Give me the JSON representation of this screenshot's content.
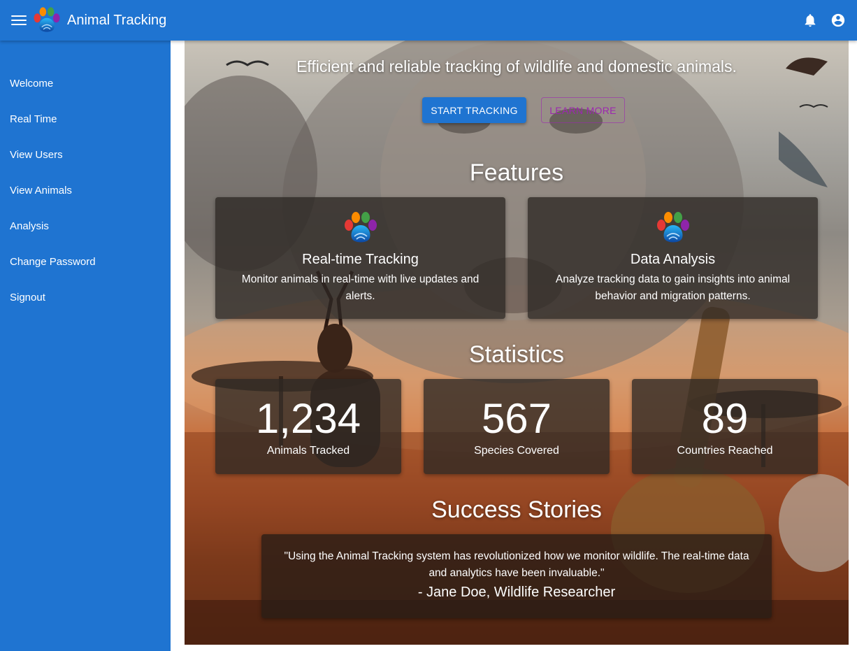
{
  "app": {
    "title": "Animal Tracking"
  },
  "icons": {
    "menu": "menu-icon",
    "logo": "paw-logo-icon",
    "notifications": "bell-icon",
    "account": "account-circle-icon",
    "feature": "paw-icon"
  },
  "colors": {
    "primary": "#1f74d1",
    "secondary": "#9c27b0"
  },
  "sidebar": {
    "items": [
      {
        "label": "Welcome"
      },
      {
        "label": "Real Time"
      },
      {
        "label": "View Users"
      },
      {
        "label": "View Animals"
      },
      {
        "label": "Analysis"
      },
      {
        "label": "Change Password"
      },
      {
        "label": "Signout"
      }
    ]
  },
  "hero": {
    "tagline": "Efficient and reliable tracking of wildlife and domestic animals.",
    "start_label": "START TRACKING",
    "learn_label": "LEARN MORE"
  },
  "features": {
    "title": "Features",
    "items": [
      {
        "title": "Real-time Tracking",
        "description": "Monitor animals in real-time with live updates and alerts."
      },
      {
        "title": "Data Analysis",
        "description": "Analyze tracking data to gain insights into animal behavior and migration patterns."
      }
    ]
  },
  "statistics": {
    "title": "Statistics",
    "items": [
      {
        "value": "1,234",
        "label": "Animals Tracked"
      },
      {
        "value": "567",
        "label": "Species Covered"
      },
      {
        "value": "89",
        "label": "Countries Reached"
      }
    ]
  },
  "stories": {
    "title": "Success Stories",
    "quote": "\"Using the Animal Tracking system has revolutionized how we monitor wildlife. The real-time data and analytics have been invaluable.\"",
    "author": "- Jane Doe, Wildlife Researcher"
  }
}
